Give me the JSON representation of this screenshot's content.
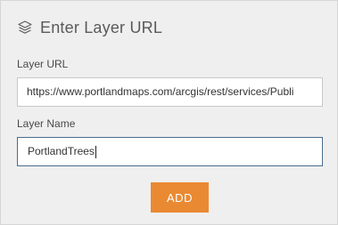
{
  "header": {
    "icon": "layers-icon",
    "title": "Enter Layer URL"
  },
  "url_field": {
    "label": "Layer URL",
    "value": "https://www.portlandmaps.com/arcgis/rest/services/Publi"
  },
  "name_field": {
    "label": "Layer Name",
    "value": "PortlandTrees"
  },
  "add_button": {
    "label": "ADD"
  },
  "colors": {
    "accent": "#e98a33",
    "panel_background": "#efefef",
    "focused_border": "#4a6e8f"
  }
}
